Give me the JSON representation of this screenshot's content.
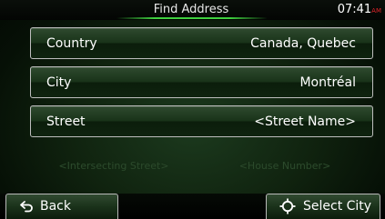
{
  "header": {
    "title": "Find Address",
    "clock": "07:41",
    "clock_suffix": "AM"
  },
  "rows": [
    {
      "label": "Country",
      "value": "Canada, Quebec"
    },
    {
      "label": "City",
      "value": "Montréal"
    },
    {
      "label": "Street",
      "value": "<Street Name>"
    }
  ],
  "disabled_buttons": {
    "intersecting_street": "<Intersecting Street>",
    "house_number": "<House Number>"
  },
  "bottom": {
    "back_label": "Back",
    "back_icon": "back-arrow-icon",
    "select_city_label": "Select City",
    "select_city_icon": "crosshair-icon"
  },
  "colors": {
    "accent_green": "#3fd03f",
    "ampm_red": "#e0242a",
    "disabled_text": "#2b4a2b"
  }
}
